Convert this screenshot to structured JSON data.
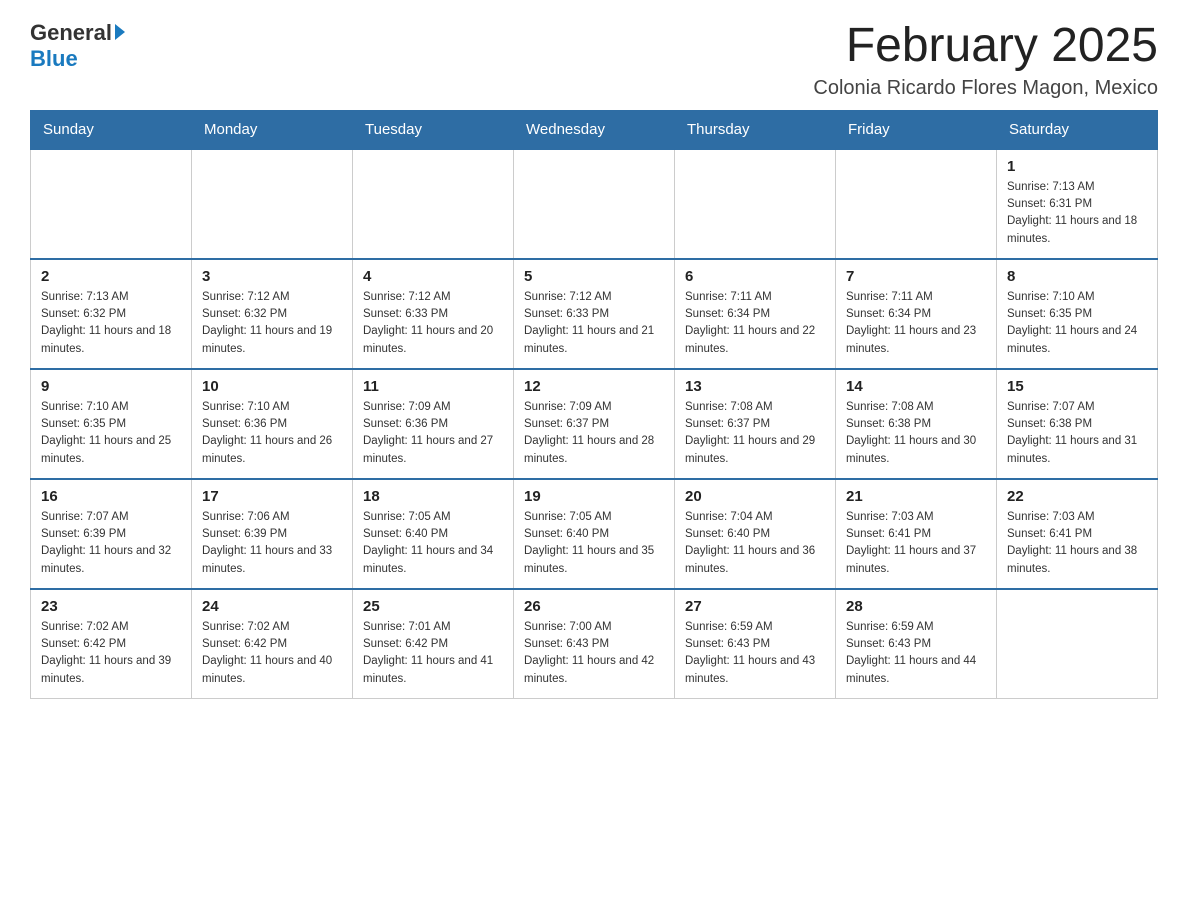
{
  "logo": {
    "general": "General",
    "blue": "Blue"
  },
  "title": "February 2025",
  "subtitle": "Colonia Ricardo Flores Magon, Mexico",
  "days_of_week": [
    "Sunday",
    "Monday",
    "Tuesday",
    "Wednesday",
    "Thursday",
    "Friday",
    "Saturday"
  ],
  "weeks": [
    [
      {
        "day": "",
        "info": ""
      },
      {
        "day": "",
        "info": ""
      },
      {
        "day": "",
        "info": ""
      },
      {
        "day": "",
        "info": ""
      },
      {
        "day": "",
        "info": ""
      },
      {
        "day": "",
        "info": ""
      },
      {
        "day": "1",
        "info": "Sunrise: 7:13 AM\nSunset: 6:31 PM\nDaylight: 11 hours and 18 minutes."
      }
    ],
    [
      {
        "day": "2",
        "info": "Sunrise: 7:13 AM\nSunset: 6:32 PM\nDaylight: 11 hours and 18 minutes."
      },
      {
        "day": "3",
        "info": "Sunrise: 7:12 AM\nSunset: 6:32 PM\nDaylight: 11 hours and 19 minutes."
      },
      {
        "day": "4",
        "info": "Sunrise: 7:12 AM\nSunset: 6:33 PM\nDaylight: 11 hours and 20 minutes."
      },
      {
        "day": "5",
        "info": "Sunrise: 7:12 AM\nSunset: 6:33 PM\nDaylight: 11 hours and 21 minutes."
      },
      {
        "day": "6",
        "info": "Sunrise: 7:11 AM\nSunset: 6:34 PM\nDaylight: 11 hours and 22 minutes."
      },
      {
        "day": "7",
        "info": "Sunrise: 7:11 AM\nSunset: 6:34 PM\nDaylight: 11 hours and 23 minutes."
      },
      {
        "day": "8",
        "info": "Sunrise: 7:10 AM\nSunset: 6:35 PM\nDaylight: 11 hours and 24 minutes."
      }
    ],
    [
      {
        "day": "9",
        "info": "Sunrise: 7:10 AM\nSunset: 6:35 PM\nDaylight: 11 hours and 25 minutes."
      },
      {
        "day": "10",
        "info": "Sunrise: 7:10 AM\nSunset: 6:36 PM\nDaylight: 11 hours and 26 minutes."
      },
      {
        "day": "11",
        "info": "Sunrise: 7:09 AM\nSunset: 6:36 PM\nDaylight: 11 hours and 27 minutes."
      },
      {
        "day": "12",
        "info": "Sunrise: 7:09 AM\nSunset: 6:37 PM\nDaylight: 11 hours and 28 minutes."
      },
      {
        "day": "13",
        "info": "Sunrise: 7:08 AM\nSunset: 6:37 PM\nDaylight: 11 hours and 29 minutes."
      },
      {
        "day": "14",
        "info": "Sunrise: 7:08 AM\nSunset: 6:38 PM\nDaylight: 11 hours and 30 minutes."
      },
      {
        "day": "15",
        "info": "Sunrise: 7:07 AM\nSunset: 6:38 PM\nDaylight: 11 hours and 31 minutes."
      }
    ],
    [
      {
        "day": "16",
        "info": "Sunrise: 7:07 AM\nSunset: 6:39 PM\nDaylight: 11 hours and 32 minutes."
      },
      {
        "day": "17",
        "info": "Sunrise: 7:06 AM\nSunset: 6:39 PM\nDaylight: 11 hours and 33 minutes."
      },
      {
        "day": "18",
        "info": "Sunrise: 7:05 AM\nSunset: 6:40 PM\nDaylight: 11 hours and 34 minutes."
      },
      {
        "day": "19",
        "info": "Sunrise: 7:05 AM\nSunset: 6:40 PM\nDaylight: 11 hours and 35 minutes."
      },
      {
        "day": "20",
        "info": "Sunrise: 7:04 AM\nSunset: 6:40 PM\nDaylight: 11 hours and 36 minutes."
      },
      {
        "day": "21",
        "info": "Sunrise: 7:03 AM\nSunset: 6:41 PM\nDaylight: 11 hours and 37 minutes."
      },
      {
        "day": "22",
        "info": "Sunrise: 7:03 AM\nSunset: 6:41 PM\nDaylight: 11 hours and 38 minutes."
      }
    ],
    [
      {
        "day": "23",
        "info": "Sunrise: 7:02 AM\nSunset: 6:42 PM\nDaylight: 11 hours and 39 minutes."
      },
      {
        "day": "24",
        "info": "Sunrise: 7:02 AM\nSunset: 6:42 PM\nDaylight: 11 hours and 40 minutes."
      },
      {
        "day": "25",
        "info": "Sunrise: 7:01 AM\nSunset: 6:42 PM\nDaylight: 11 hours and 41 minutes."
      },
      {
        "day": "26",
        "info": "Sunrise: 7:00 AM\nSunset: 6:43 PM\nDaylight: 11 hours and 42 minutes."
      },
      {
        "day": "27",
        "info": "Sunrise: 6:59 AM\nSunset: 6:43 PM\nDaylight: 11 hours and 43 minutes."
      },
      {
        "day": "28",
        "info": "Sunrise: 6:59 AM\nSunset: 6:43 PM\nDaylight: 11 hours and 44 minutes."
      },
      {
        "day": "",
        "info": ""
      }
    ]
  ]
}
